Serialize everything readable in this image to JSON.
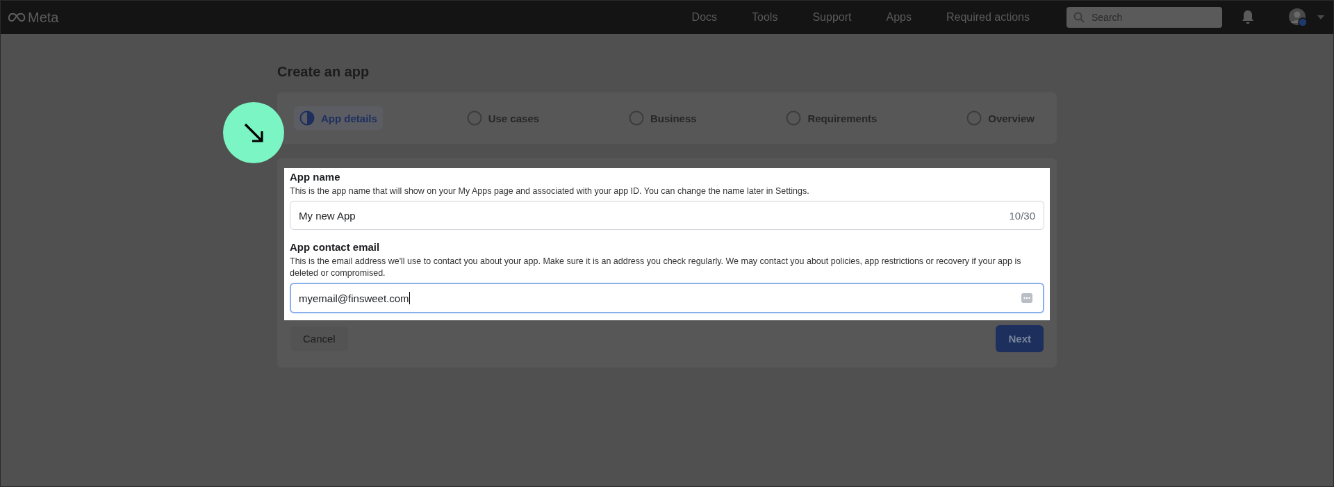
{
  "top_bar": {
    "logo": "Meta",
    "nav": [
      "Docs",
      "Tools",
      "Support",
      "Apps",
      "Required actions"
    ],
    "search": {
      "placeholder": "Search"
    }
  },
  "page": {
    "title": "Create an app"
  },
  "steps": [
    {
      "label": "App details",
      "selected": true
    },
    {
      "label": "Use cases",
      "selected": false
    },
    {
      "label": "Business",
      "selected": false
    },
    {
      "label": "Requirements",
      "selected": false
    },
    {
      "label": "Overview",
      "selected": false
    }
  ],
  "form": {
    "fields": [
      {
        "label": "App name",
        "help": "This is the app name that will show on your My Apps page and associated with your app ID. You can change the name later in Settings.",
        "value": "My new App",
        "counter": "10/30",
        "focused": false
      },
      {
        "label": "App contact email",
        "help": "This is the email address we'll use to contact you about your app. Make sure it is an address you check regularly. We may contact you about policies, app restrictions or recovery if your app is deleted or compromised.",
        "value": "myemail@finsweet.com",
        "focused": true
      }
    ]
  },
  "buttons": {
    "cancel": "Cancel",
    "next": "Next"
  }
}
